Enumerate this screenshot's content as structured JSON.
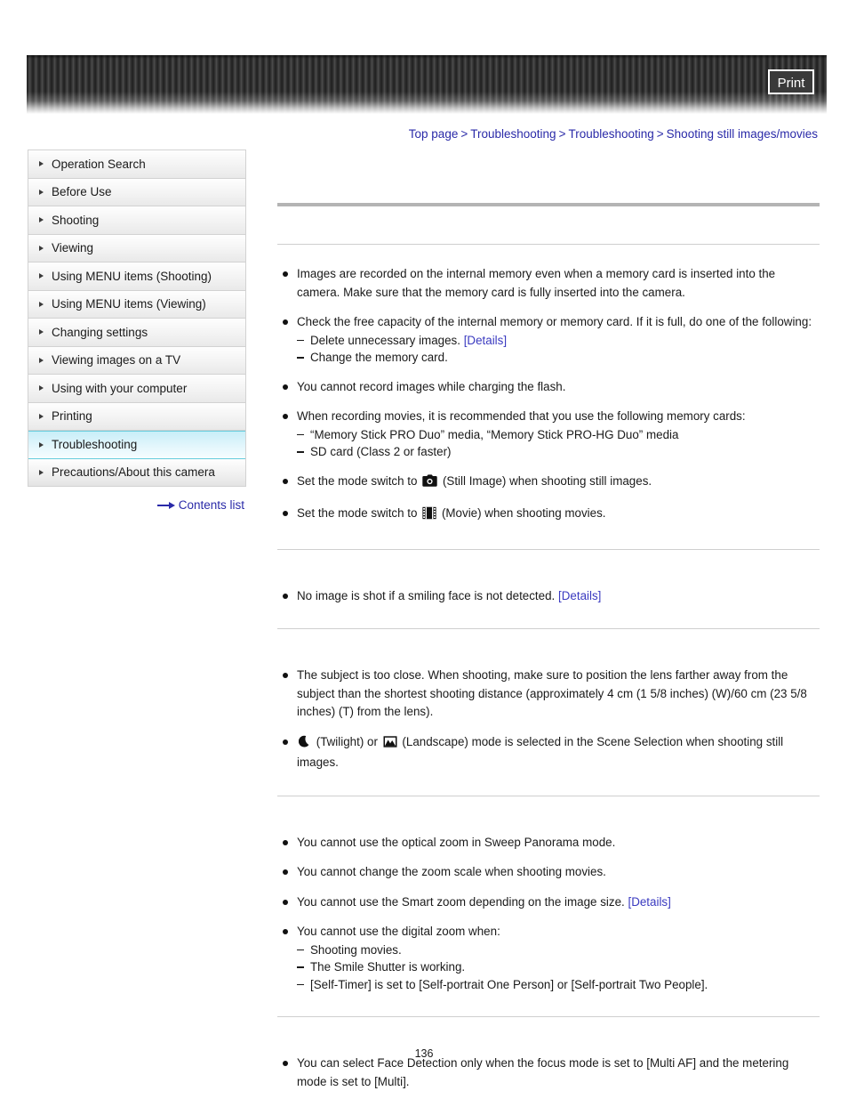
{
  "header": {
    "print_label": "Print"
  },
  "breadcrumb": {
    "items": [
      {
        "label": "Top page"
      },
      {
        "label": "Troubleshooting"
      },
      {
        "label": "Troubleshooting"
      },
      {
        "label": "Shooting still images/movies"
      }
    ],
    "separator": ">"
  },
  "sidebar": {
    "items": [
      {
        "label": "Operation Search",
        "active": false
      },
      {
        "label": "Before Use",
        "active": false
      },
      {
        "label": "Shooting",
        "active": false
      },
      {
        "label": "Viewing",
        "active": false
      },
      {
        "label": "Using MENU items (Shooting)",
        "active": false
      },
      {
        "label": "Using MENU items (Viewing)",
        "active": false
      },
      {
        "label": "Changing settings",
        "active": false
      },
      {
        "label": "Viewing images on a TV",
        "active": false
      },
      {
        "label": "Using with your computer",
        "active": false
      },
      {
        "label": "Printing",
        "active": false
      },
      {
        "label": "Troubleshooting",
        "active": true
      },
      {
        "label": "Precautions/About this camera",
        "active": false
      }
    ],
    "contents_link": "Contents list"
  },
  "page": {
    "title": "",
    "number": "136",
    "details_label": "[Details]",
    "sections": [
      {
        "heading": "",
        "bullets": [
          {
            "text_before": "Images are recorded on the internal memory even when a memory card is inserted into the camera. Make sure that the memory card is fully inserted into the camera.",
            "sub": []
          },
          {
            "text_before": "Check the free capacity of the internal memory or memory card. If it is full, do one of the following:",
            "sub": [
              {
                "text_before": "Delete unnecessary images.",
                "link": "[Details]",
                "text_after": ""
              },
              {
                "text_before": "Change the memory card.",
                "link": "",
                "text_after": ""
              }
            ]
          },
          {
            "text_before": "You cannot record images while charging the flash.",
            "sub": []
          },
          {
            "text_before": "When recording movies, it is recommended that you use the following memory cards:",
            "sub": [
              {
                "text_before": "“Memory Stick PRO Duo” media, “Memory Stick PRO-HG Duo” media",
                "link": "",
                "text_after": ""
              },
              {
                "text_before": "SD card (Class 2 or faster)",
                "link": "",
                "text_after": ""
              }
            ]
          },
          {
            "text_before": "Set the mode switch to",
            "icon": "still-image-camera-icon",
            "text_after": "(Still Image) when shooting still images.",
            "sub": []
          },
          {
            "text_before": "Set the mode switch to",
            "icon": "movie-filmstrip-icon",
            "text_after": "(Movie) when shooting movies.",
            "sub": []
          }
        ]
      },
      {
        "heading": "",
        "bullets": [
          {
            "text_before": "No image is shot if a smiling face is not detected.",
            "link": "[Details]",
            "sub": []
          }
        ]
      },
      {
        "heading": "",
        "bullets": [
          {
            "text_before": "The subject is too close. When shooting, make sure to position the lens farther away from the subject than the shortest shooting distance (approximately 4 cm (1 5/8 inches) (W)/60 cm (23 5/8 inches) (T) from the lens).",
            "sub": []
          },
          {
            "icon_lead": "twilight-moon-icon",
            "text_mid": "(Twilight) or",
            "icon_mid": "landscape-mountain-icon",
            "text_after": "(Landscape) mode is selected in the Scene Selection when shooting still images.",
            "sub": []
          }
        ]
      },
      {
        "heading": "",
        "bullets": [
          {
            "text_before": "You cannot use the optical zoom in Sweep Panorama mode.",
            "sub": []
          },
          {
            "text_before": "You cannot change the zoom scale when shooting movies.",
            "sub": []
          },
          {
            "text_before": "You cannot use the Smart zoom depending on the image size.",
            "link": "[Details]",
            "sub": []
          },
          {
            "text_before": "You cannot use the digital zoom when:",
            "sub": [
              {
                "text_before": "Shooting movies.",
                "link": "",
                "text_after": ""
              },
              {
                "text_before": "The Smile Shutter is working.",
                "link": "",
                "text_after": ""
              },
              {
                "text_before": "[Self-Timer] is set to [Self-portrait One Person] or [Self-portrait Two People].",
                "link": "",
                "text_after": ""
              }
            ]
          }
        ]
      },
      {
        "heading": "",
        "bullets": [
          {
            "text_before": "You can select Face Detection only when the focus mode is set to [Multi AF] and the metering mode is set to [Multi].",
            "sub": []
          }
        ]
      }
    ]
  },
  "colors": {
    "link": "#2a2aa8",
    "detail_link": "#3a3ac0",
    "active_sidebar": "#c8eef8",
    "rule_thick": "#b4b4b4",
    "rule_thin": "#cfcfcf"
  }
}
